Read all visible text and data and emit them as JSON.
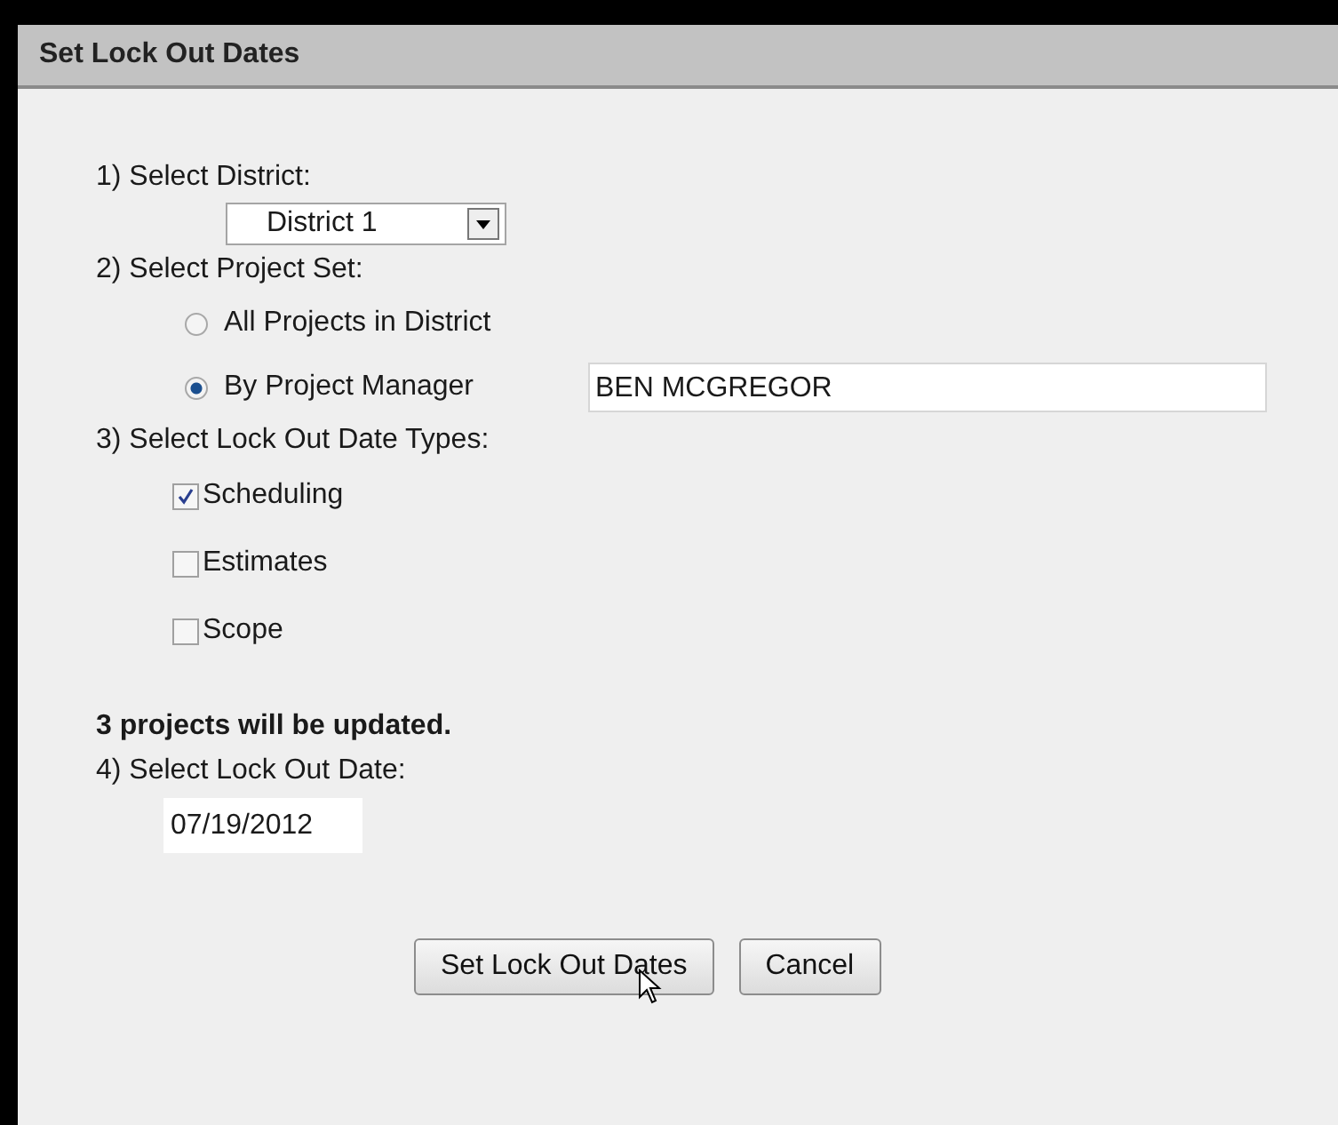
{
  "window": {
    "title": "Set Lock Out Dates"
  },
  "district": {
    "label": "1) Select District:",
    "value": "District 1"
  },
  "project_set": {
    "label": "2) Select Project Set:",
    "options": [
      {
        "label": "All Projects in District",
        "selected": false
      },
      {
        "label": "By Project Manager",
        "selected": true,
        "value": "BEN MCGREGOR"
      }
    ]
  },
  "date_types": {
    "label": "3) Select Lock Out Date Types:",
    "items": [
      {
        "label": "Scheduling",
        "checked": true
      },
      {
        "label": "Estimates",
        "checked": false
      },
      {
        "label": "Scope",
        "checked": false
      }
    ]
  },
  "summary": "3 projects will be updated.",
  "lock_date": {
    "label": "4) Select Lock Out Date:",
    "value": "07/19/2012"
  },
  "buttons": [
    "Set Lock Out Dates",
    "Cancel"
  ]
}
